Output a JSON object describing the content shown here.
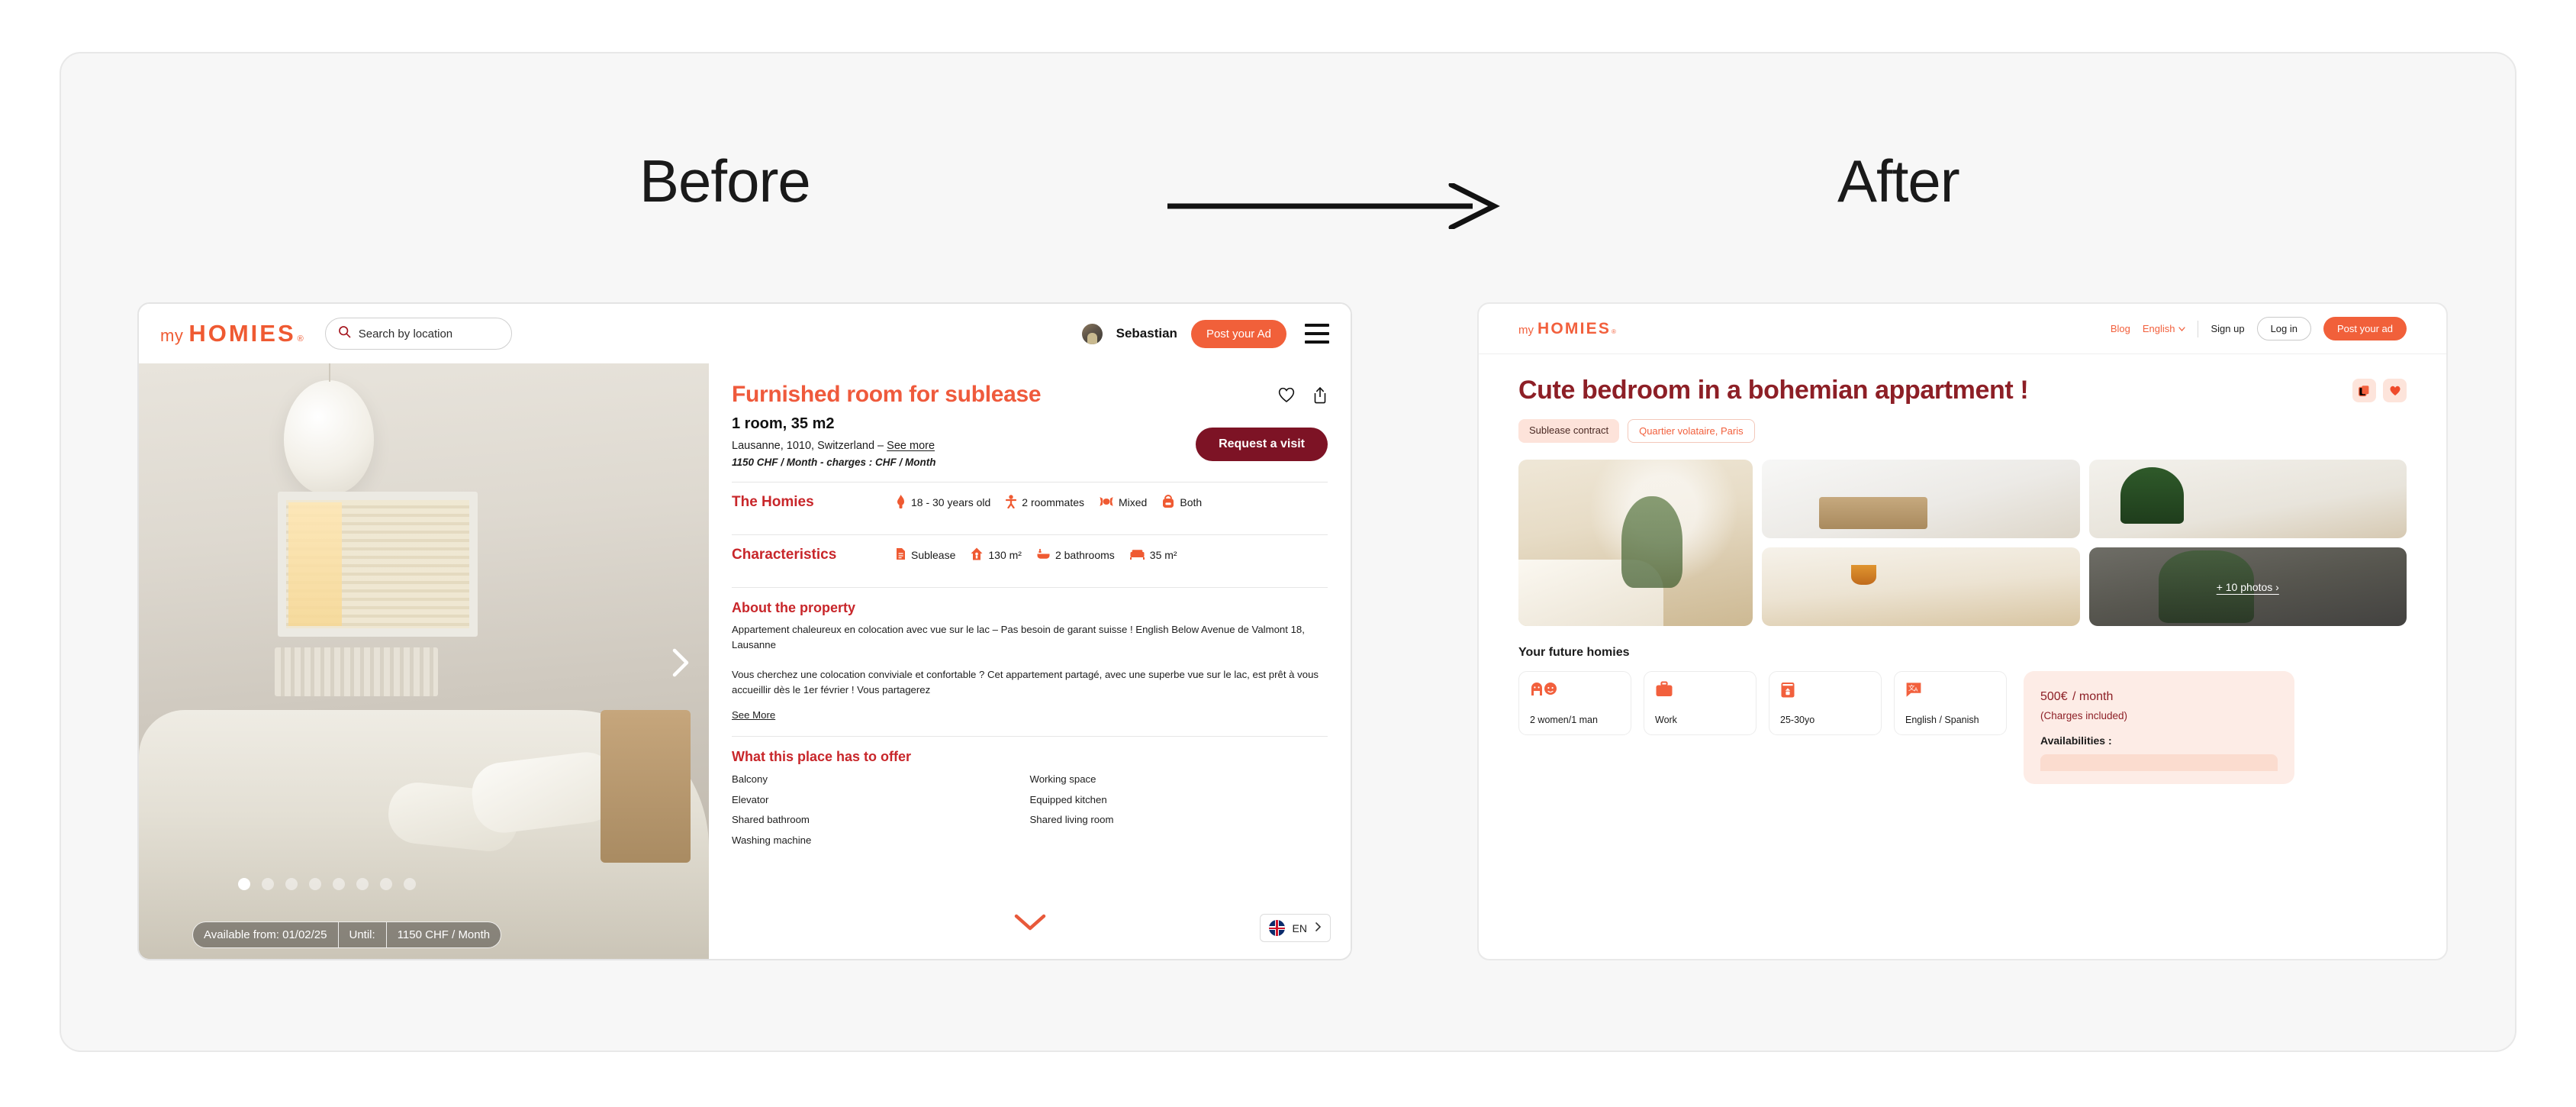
{
  "headings": {
    "before": "Before",
    "after": "After",
    "arrow_icon": "long-right-arrow-icon"
  },
  "before": {
    "header": {
      "logo_my": "my",
      "logo_homies": "HOMIES",
      "logo_reg": "®",
      "search_placeholder": "Search by location",
      "search_icon": "search-icon",
      "user_name": "Sebastian",
      "post_ad_label": "Post your Ad",
      "menu_icon": "hamburger-menu-icon"
    },
    "photo": {
      "dots_total": 8,
      "dots_active_index": 0,
      "next_icon": "chevron-right-icon",
      "availability": {
        "from_label": "Available from: 01/02/25",
        "until_label": "Until:",
        "price_label": "1150 CHF  / Month"
      }
    },
    "listing": {
      "title": "Furnished room for sublease",
      "favorite_icon": "heart-outline-icon",
      "share_icon": "share-upload-icon",
      "subtitle": "1 room, 35 m2",
      "location": "Lausanne, 1010, Switzerland – ",
      "location_link": "See more",
      "price_line": "1150 CHF / Month - charges :  CHF / Month",
      "request_visit_label": "Request a visit"
    },
    "homies_row": {
      "label": "The Homies",
      "items": [
        {
          "icon": "flame-icon",
          "text": "18 - 30 years old"
        },
        {
          "icon": "person-icon",
          "text": "2 roommates"
        },
        {
          "icon": "candy-icon",
          "text": "Mixed"
        },
        {
          "icon": "backpack-icon",
          "text": "Both"
        }
      ]
    },
    "characteristics_row": {
      "label": "Characteristics",
      "items": [
        {
          "icon": "document-icon",
          "text": "Sublease"
        },
        {
          "icon": "house-icon",
          "text": "130 m²"
        },
        {
          "icon": "bathtub-icon",
          "text": "2 bathrooms"
        },
        {
          "icon": "bed-icon",
          "text": "35 m²"
        }
      ]
    },
    "about": {
      "heading": "About the property",
      "paragraph1": "Appartement chaleureux en colocation avec vue sur le lac – Pas besoin de garant suisse ! English Below Avenue de Valmont 18, Lausanne",
      "paragraph2": "Vous cherchez une colocation conviviale et confortable ? Cet appartement partagé, avec une superbe vue sur le lac, est prêt à vous accueillir dès le 1er février ! Vous partagerez",
      "see_more": "See More"
    },
    "offer": {
      "heading": "What this place has to offer",
      "items": [
        "Balcony",
        "Working space",
        "Elevator",
        "Equipped kitchen",
        "Shared bathroom",
        "Shared living room",
        "Washing machine"
      ]
    },
    "footer": {
      "expand_icon": "chevron-down-icon",
      "flag_icon": "uk-flag-icon",
      "lang_code": "EN",
      "lang_chevron_icon": "chevron-right-icon"
    }
  },
  "after": {
    "header": {
      "logo_my": "my",
      "logo_homies": "HOMIES",
      "logo_reg": "®",
      "blog_label": "Blog",
      "english_label": "English",
      "english_chevron_icon": "chevron-down-icon",
      "signup_label": "Sign up",
      "login_label": "Log in",
      "post_ad_label": "Post your ad"
    },
    "listing": {
      "title": "Cute bedroom in a bohemian appartment !",
      "copy_icon": "copy-link-icon",
      "favorite_icon": "heart-filled-icon",
      "tags": [
        {
          "text": "Sublease contract",
          "style": "filled"
        },
        {
          "text": "Quartier volataire, Paris",
          "style": "outline"
        }
      ]
    },
    "gallery": {
      "main_photo_name": "bohemian-bedroom-photo",
      "thumbs": [
        {
          "name": "bathroom-photo"
        },
        {
          "name": "plant-corner-photo"
        },
        {
          "name": "dining-room-photo"
        },
        {
          "name": "balcony-plants-photo"
        }
      ],
      "more_label": "+ 10 photos ›"
    },
    "homies": {
      "heading": "Your future homies",
      "cards": [
        {
          "icon": "two-women-one-man-icon",
          "label": "2 women/1 man"
        },
        {
          "icon": "briefcase-icon",
          "label": "Work"
        },
        {
          "icon": "calendar-age-icon",
          "label": "25-30yo"
        },
        {
          "icon": "translate-icon",
          "label": "English / Spanish"
        }
      ]
    },
    "price": {
      "amount": "500€",
      "period": "/ month",
      "charges": "(Charges included)",
      "availabilities_label": "Availabilities :"
    }
  },
  "colors": {
    "brand_orange": "#f1603a",
    "title_orange": "#ef5a3c",
    "deep_red": "#8d1f26",
    "section_red": "#c8262a",
    "visit_button": "#7d1325",
    "tag_bg": "#fde3da",
    "price_card_bg": "#fdece6"
  }
}
